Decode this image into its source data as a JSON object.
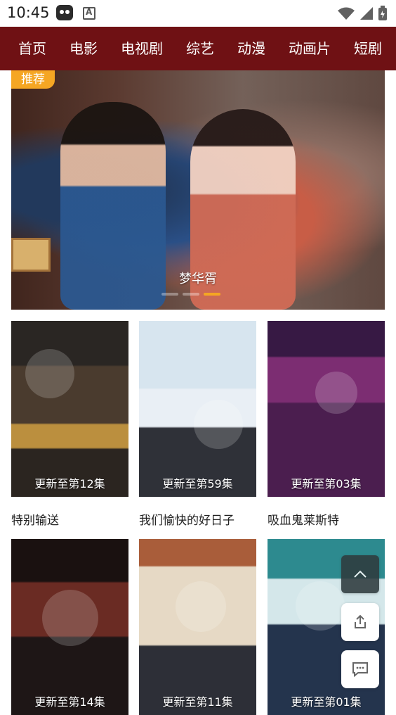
{
  "status_bar": {
    "time": "10:45"
  },
  "nav": {
    "tabs": [
      "首页",
      "电影",
      "电视剧",
      "综艺",
      "动漫",
      "动画片",
      "短剧"
    ]
  },
  "banner": {
    "badge": "推荐",
    "caption": "梦华胥",
    "active_dot": 2,
    "dots": 3
  },
  "cards": [
    {
      "title": "特别输送",
      "update": "更新至第12集"
    },
    {
      "title": "我们愉快的好日子",
      "update": "更新至第59集"
    },
    {
      "title": "吸血鬼莱斯特",
      "update": "更新至第03集"
    },
    {
      "title": "",
      "update": "更新至第14集"
    },
    {
      "title": "",
      "update": "更新至第11集"
    },
    {
      "title": "",
      "update": "更新至第01集"
    }
  ],
  "floating_actions": {
    "icons": [
      "chevron-up-icon",
      "share-icon",
      "comment-icon"
    ]
  },
  "colors": {
    "nav_bg": "#6f1114",
    "accent": "#f5a623"
  }
}
